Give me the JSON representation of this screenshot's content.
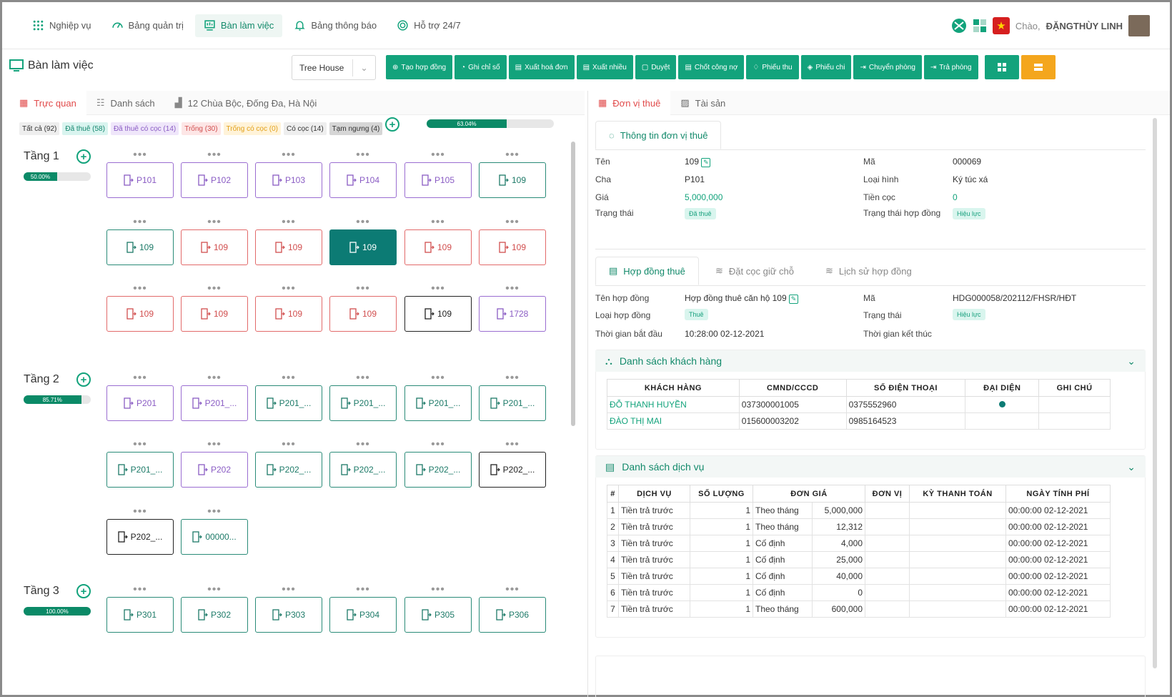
{
  "nav": {
    "items": [
      {
        "label": "Nghiệp vụ",
        "icon": "grid-icon"
      },
      {
        "label": "Bảng quản trị",
        "icon": "dashboard-icon"
      },
      {
        "label": "Bàn làm việc",
        "icon": "desk-icon",
        "active": true
      },
      {
        "label": "Bảng thông báo",
        "icon": "bell-icon"
      },
      {
        "label": "Hỗ trợ 24/7",
        "icon": "headset-icon"
      }
    ],
    "greeting": "Chào,",
    "user": "ĐẶNGTHÙY LINH"
  },
  "title": "Bàn làm việc",
  "building_select": "Tree House",
  "actions": [
    "Tạo hợp đồng",
    "Ghi chỉ số",
    "Xuất hoá đơn",
    "Xuất nhiều",
    "Duyệt",
    "Chốt công nợ",
    "Phiếu thu",
    "Phiếu chi",
    "Chuyển phòng",
    "Trả phòng"
  ],
  "left_tabs": {
    "visual": "Trực quan",
    "list": "Danh sách",
    "address": "12 Chùa Bộc, Đống Đa, Hà Nội"
  },
  "filters": [
    {
      "label": "Tất cả (92)",
      "bg": "#eeeeee",
      "fg": "#333333"
    },
    {
      "label": "Đã thuê (58)",
      "bg": "#d9f4ef",
      "fg": "#15876f"
    },
    {
      "label": "Đã thuê có cọc (14)",
      "bg": "#efe6fa",
      "fg": "#8a5cc4"
    },
    {
      "label": "Trống (30)",
      "bg": "#fde6e6",
      "fg": "#d14e4e"
    },
    {
      "label": "Trống có cọc (0)",
      "bg": "#fff3d9",
      "fg": "#e2a019"
    },
    {
      "label": "Có cọc (14)",
      "bg": "#eeeeee",
      "fg": "#333333"
    },
    {
      "label": "Tạm ngưng (4)",
      "bg": "#d6d6d6",
      "fg": "#333333"
    }
  ],
  "overall_progress": {
    "label": "63.04%",
    "value": 63.04
  },
  "floors": [
    {
      "name": "Tầng 1",
      "progress_label": "50.00%",
      "progress": 50
    },
    {
      "name": "Tầng 2",
      "progress_label": "85.71%",
      "progress": 85.71
    },
    {
      "name": "Tầng 3",
      "progress_label": "100.00%",
      "progress": 100
    }
  ],
  "rooms": {
    "floor1": [
      [
        {
          "n": "P101",
          "s": "purple"
        },
        {
          "n": "P102",
          "s": "purple"
        },
        {
          "n": "P103",
          "s": "purple"
        },
        {
          "n": "P104",
          "s": "purple"
        },
        {
          "n": "P105",
          "s": "purple"
        },
        {
          "n": "109",
          "s": "teal"
        }
      ],
      [
        {
          "n": "109",
          "s": "teal"
        },
        {
          "n": "109",
          "s": "red"
        },
        {
          "n": "109",
          "s": "red"
        },
        {
          "n": "109",
          "s": "tealfill"
        },
        {
          "n": "109",
          "s": "red"
        },
        {
          "n": "109",
          "s": "red"
        }
      ],
      [
        {
          "n": "109",
          "s": "red"
        },
        {
          "n": "109",
          "s": "red"
        },
        {
          "n": "109",
          "s": "red"
        },
        {
          "n": "109",
          "s": "red"
        },
        {
          "n": "109",
          "s": "black"
        },
        {
          "n": "1728",
          "s": "purple"
        }
      ]
    ],
    "floor2": [
      [
        {
          "n": "P201",
          "s": "purple"
        },
        {
          "n": "P201_...",
          "s": "purple"
        },
        {
          "n": "P201_...",
          "s": "teal"
        },
        {
          "n": "P201_...",
          "s": "teal"
        },
        {
          "n": "P201_...",
          "s": "teal"
        },
        {
          "n": "P201_...",
          "s": "teal"
        }
      ],
      [
        {
          "n": "P201_...",
          "s": "teal"
        },
        {
          "n": "P202",
          "s": "purple"
        },
        {
          "n": "P202_...",
          "s": "teal"
        },
        {
          "n": "P202_...",
          "s": "teal"
        },
        {
          "n": "P202_...",
          "s": "teal"
        },
        {
          "n": "P202_...",
          "s": "black"
        }
      ],
      [
        {
          "n": "P202_...",
          "s": "black"
        },
        {
          "n": "00000...",
          "s": "teal"
        }
      ]
    ],
    "floor3": [
      [
        {
          "n": "P301",
          "s": "teal"
        },
        {
          "n": "P302",
          "s": "teal"
        },
        {
          "n": "P303",
          "s": "teal"
        },
        {
          "n": "P304",
          "s": "teal"
        },
        {
          "n": "P305",
          "s": "teal"
        },
        {
          "n": "P306",
          "s": "teal"
        }
      ]
    ]
  },
  "right_tabs": {
    "unit": "Đơn vị thuê",
    "asset": "Tài sản"
  },
  "unit_info": {
    "tab": "Thông tin đơn vị thuê",
    "ten_k": "Tên",
    "ten_v": "109",
    "cha_k": "Cha",
    "cha_v": "P101",
    "gia_k": "Giá",
    "gia_v": "5,000,000",
    "tt_k": "Trạng thái",
    "tt_v": "Đã thuê",
    "ma_k": "Mã",
    "ma_v": "000069",
    "lh_k": "Loại hình",
    "lh_v": "Ký túc xá",
    "tc_k": "Tiền cọc",
    "tc_v": "0",
    "tthd_k": "Trạng thái hợp đồng",
    "tthd_v": "Hiệu lực"
  },
  "contract_tabs": [
    "Hợp đồng thuê",
    "Đặt cọc giữ chỗ",
    "Lịch sử hợp đồng"
  ],
  "contract": {
    "name_k": "Tên hợp đồng",
    "name_v": "Hợp đồng thuê căn hộ 109",
    "type_k": "Loại hợp đồng",
    "type_v": "Thuê",
    "start_k": "Thời gian bắt đầu",
    "start_v": "10:28:00 02-12-2021",
    "ma_k": "Mã",
    "ma_v": "HDG000058/202112/FHSR/HĐT",
    "st_k": "Trạng thái",
    "st_v": "Hiệu lực",
    "end_k": "Thời gian kết thúc"
  },
  "customers": {
    "title": "Danh sách khách hàng",
    "headers": [
      "KHÁCH HÀNG",
      "CMND/CCCD",
      "SỐ ĐIỆN THOẠI",
      "ĐẠI DIỆN",
      "GHI CHÚ"
    ],
    "rows": [
      {
        "name": "ĐỖ THANH HUYỀN",
        "id": "037300001005",
        "phone": "0375552960",
        "rep": true
      },
      {
        "name": "ĐÀO THỊ MAI",
        "id": "015600003202",
        "phone": "0985164523",
        "rep": false
      }
    ]
  },
  "services": {
    "title": "Danh sách dịch vụ",
    "headers": [
      "#",
      "DỊCH VỤ",
      "SỐ LƯỢNG",
      "ĐƠN GIÁ",
      "ĐƠN VỊ",
      "KỲ THANH TOÁN",
      "NGÀY TÍNH PHÍ"
    ],
    "rows": [
      [
        "1",
        "Tiền trả trước",
        "1",
        "Theo tháng",
        "5,000,000",
        "00:00:00 02-12-2021"
      ],
      [
        "2",
        "Tiền trả trước",
        "1",
        "Theo tháng",
        "12,312",
        "00:00:00 02-12-2021"
      ],
      [
        "3",
        "Tiền trả trước",
        "1",
        "Cố định",
        "4,000",
        "00:00:00 02-12-2021"
      ],
      [
        "4",
        "Tiền trả trước",
        "1",
        "Cố định",
        "25,000",
        "00:00:00 02-12-2021"
      ],
      [
        "5",
        "Tiền trả trước",
        "1",
        "Cố định",
        "40,000",
        "00:00:00 02-12-2021"
      ],
      [
        "6",
        "Tiền trả trước",
        "1",
        "Cố định",
        "0",
        "00:00:00 02-12-2021"
      ],
      [
        "7",
        "Tiền trả trước",
        "1",
        "Theo tháng",
        "600,000",
        "00:00:00 02-12-2021"
      ]
    ]
  },
  "colors": {
    "primary": "#13a37c",
    "accent_orange": "#f4a61d",
    "dark_teal": "#0c7b74"
  }
}
